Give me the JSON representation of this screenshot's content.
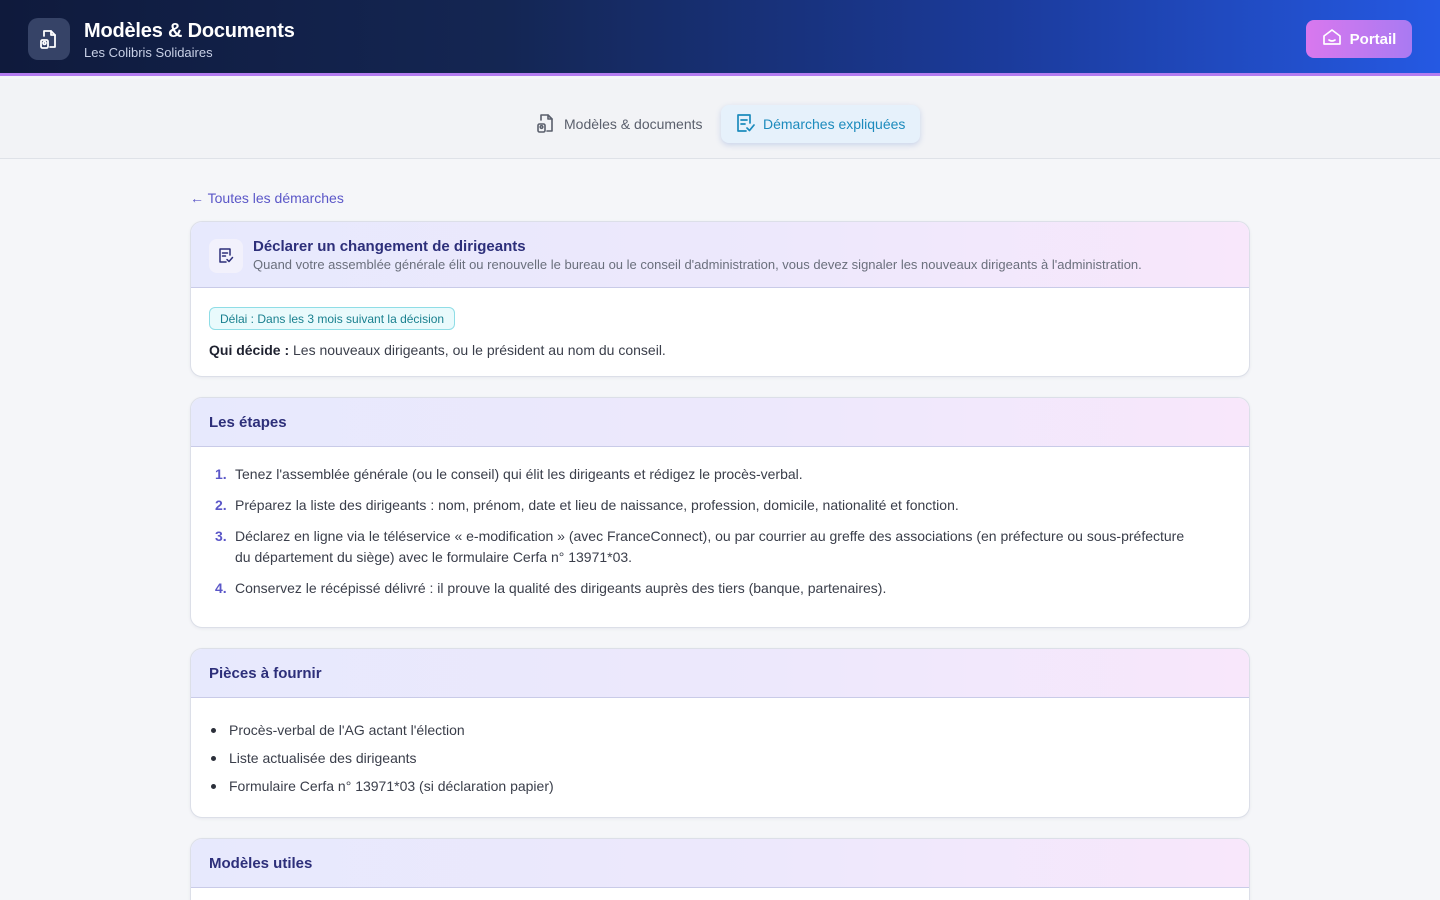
{
  "header": {
    "title": "Modèles & Documents",
    "subtitle": "Les Colibris Solidaires",
    "portal_label": "Portail",
    "app_icon": "document-icon",
    "portal_icon": "home-icon"
  },
  "tabs": [
    {
      "label": "Modèles & documents",
      "icon": "document-icon",
      "active": false
    },
    {
      "label": "Démarches expliquées",
      "icon": "checklist-icon",
      "active": true
    }
  ],
  "back_link": "← Toutes les démarches",
  "procedure": {
    "title": "Déclarer un changement de dirigeants",
    "description": "Quand votre assemblée générale élit ou renouvelle le bureau ou le conseil d'administration, vous devez signaler les nouveaux dirigeants à l'administration.",
    "deadline": "Délai : Dans les 3 mois suivant la décision",
    "who_label": "Qui décide :",
    "who_value": "Les nouveaux dirigeants, ou le président au nom du conseil."
  },
  "steps_section": {
    "title": "Les étapes",
    "items": [
      {
        "num": "1.",
        "text": "Tenez l'assemblée générale (ou le conseil) qui élit les dirigeants et rédigez le procès-verbal."
      },
      {
        "num": "2.",
        "text": "Préparez la liste des dirigeants : nom, prénom, date et lieu de naissance, profession, domicile, nationalité et fonction."
      },
      {
        "num": "3.",
        "text": "Déclarez en ligne via le téléservice « e-modification » (avec FranceConnect), ou par courrier au greffe des associations (en préfecture ou sous-préfecture du département du siège) avec le formulaire Cerfa n° 13971*03."
      },
      {
        "num": "4.",
        "text": "Conservez le récépissé délivré : il prouve la qualité des dirigeants auprès des tiers (banque, partenaires)."
      }
    ]
  },
  "pieces_section": {
    "title": "Pièces à fournir",
    "items": [
      "Procès-verbal de l'AG actant l'élection",
      "Liste actualisée des dirigeants",
      "Formulaire Cerfa n° 13971*03 (si déclaration papier)"
    ]
  },
  "models_section": {
    "title": "Modèles utiles"
  },
  "colors": {
    "header_start": "#0f1a3c",
    "header_end": "#2559e3",
    "accent": "#5b57c8",
    "active_tab": "#1c8bbd",
    "badge": "#19808f"
  }
}
